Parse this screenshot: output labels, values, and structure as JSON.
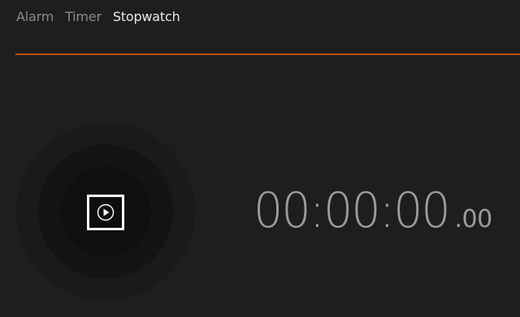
{
  "tabs": [
    {
      "label": "Alarm",
      "active": false
    },
    {
      "label": "Timer",
      "active": false
    },
    {
      "label": "Stopwatch",
      "active": true
    }
  ],
  "colors": {
    "background": "#1e1e1e",
    "accent": "#b84f12",
    "active_tab": "#e8e8e8",
    "inactive_tab": "#8a8a8a",
    "time_text": "#9c9c9c"
  },
  "stopwatch": {
    "time_main": "00:00:00",
    "time_fraction": ".00",
    "start_button_icon": "play-icon"
  }
}
